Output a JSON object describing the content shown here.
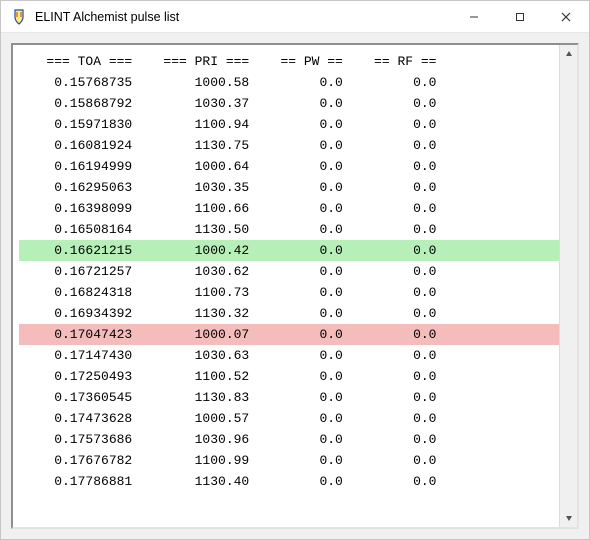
{
  "window": {
    "title": "ELINT Alchemist pulse list"
  },
  "headers": {
    "toa": "=== TOA ===",
    "pri": "=== PRI ===",
    "pw": "== PW ==",
    "rf": "== RF =="
  },
  "rows": [
    {
      "toa": "0.15768735",
      "pri": "1000.58",
      "pw": "0.0",
      "rf": "0.0",
      "hl": null
    },
    {
      "toa": "0.15868792",
      "pri": "1030.37",
      "pw": "0.0",
      "rf": "0.0",
      "hl": null
    },
    {
      "toa": "0.15971830",
      "pri": "1100.94",
      "pw": "0.0",
      "rf": "0.0",
      "hl": null
    },
    {
      "toa": "0.16081924",
      "pri": "1130.75",
      "pw": "0.0",
      "rf": "0.0",
      "hl": null
    },
    {
      "toa": "0.16194999",
      "pri": "1000.64",
      "pw": "0.0",
      "rf": "0.0",
      "hl": null
    },
    {
      "toa": "0.16295063",
      "pri": "1030.35",
      "pw": "0.0",
      "rf": "0.0",
      "hl": null
    },
    {
      "toa": "0.16398099",
      "pri": "1100.66",
      "pw": "0.0",
      "rf": "0.0",
      "hl": null
    },
    {
      "toa": "0.16508164",
      "pri": "1130.50",
      "pw": "0.0",
      "rf": "0.0",
      "hl": null
    },
    {
      "toa": "0.16621215",
      "pri": "1000.42",
      "pw": "0.0",
      "rf": "0.0",
      "hl": "green"
    },
    {
      "toa": "0.16721257",
      "pri": "1030.62",
      "pw": "0.0",
      "rf": "0.0",
      "hl": null
    },
    {
      "toa": "0.16824318",
      "pri": "1100.73",
      "pw": "0.0",
      "rf": "0.0",
      "hl": null
    },
    {
      "toa": "0.16934392",
      "pri": "1130.32",
      "pw": "0.0",
      "rf": "0.0",
      "hl": null
    },
    {
      "toa": "0.17047423",
      "pri": "1000.07",
      "pw": "0.0",
      "rf": "0.0",
      "hl": "red"
    },
    {
      "toa": "0.17147430",
      "pri": "1030.63",
      "pw": "0.0",
      "rf": "0.0",
      "hl": null
    },
    {
      "toa": "0.17250493",
      "pri": "1100.52",
      "pw": "0.0",
      "rf": "0.0",
      "hl": null
    },
    {
      "toa": "0.17360545",
      "pri": "1130.83",
      "pw": "0.0",
      "rf": "0.0",
      "hl": null
    },
    {
      "toa": "0.17473628",
      "pri": "1000.57",
      "pw": "0.0",
      "rf": "0.0",
      "hl": null
    },
    {
      "toa": "0.17573686",
      "pri": "1030.96",
      "pw": "0.0",
      "rf": "0.0",
      "hl": null
    },
    {
      "toa": "0.17676782",
      "pri": "1100.99",
      "pw": "0.0",
      "rf": "0.0",
      "hl": null
    },
    {
      "toa": "0.17786881",
      "pri": "1130.40",
      "pw": "0.0",
      "rf": "0.0",
      "hl": null
    }
  ],
  "col_widths": {
    "toa": 14,
    "pri": 15,
    "pw": 12,
    "rf": 12
  }
}
